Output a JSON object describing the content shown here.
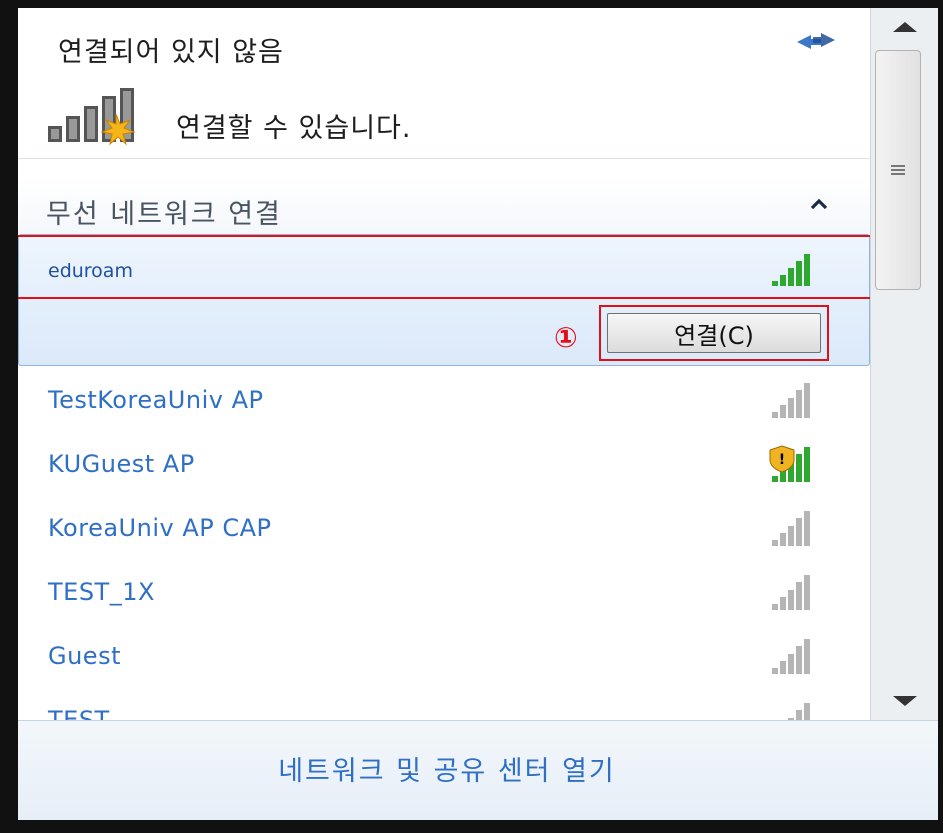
{
  "status": {
    "title": "연결되어 있지 않음",
    "available_text": "연결할 수 있습니다."
  },
  "section": {
    "title": "무선 네트워크 연결"
  },
  "selected_network": {
    "name": "eduroam",
    "step_marker": "①",
    "connect_label": "연결(C)",
    "signal_icon": "signal-bars-green"
  },
  "networks": [
    {
      "name": "TestKoreaUniv AP",
      "signal_icon": "signal-bars-gray"
    },
    {
      "name": "KUGuest AP",
      "signal_icon": "signal-bars-green-shield-warning"
    },
    {
      "name": "KoreaUniv AP CAP",
      "signal_icon": "signal-bars-gray"
    },
    {
      "name": "TEST_1X",
      "signal_icon": "signal-bars-gray"
    },
    {
      "name": "Guest",
      "signal_icon": "signal-bars-gray"
    },
    {
      "name": "TEST",
      "signal_icon": "signal-bars-gray"
    }
  ],
  "footer": {
    "link": "네트워크 및 공유 센터 열기"
  },
  "colors": {
    "link": "#2f6fc4",
    "highlight": "#e20f14",
    "signal_green": "#2ea82e",
    "signal_gray": "#b5b5b5"
  }
}
